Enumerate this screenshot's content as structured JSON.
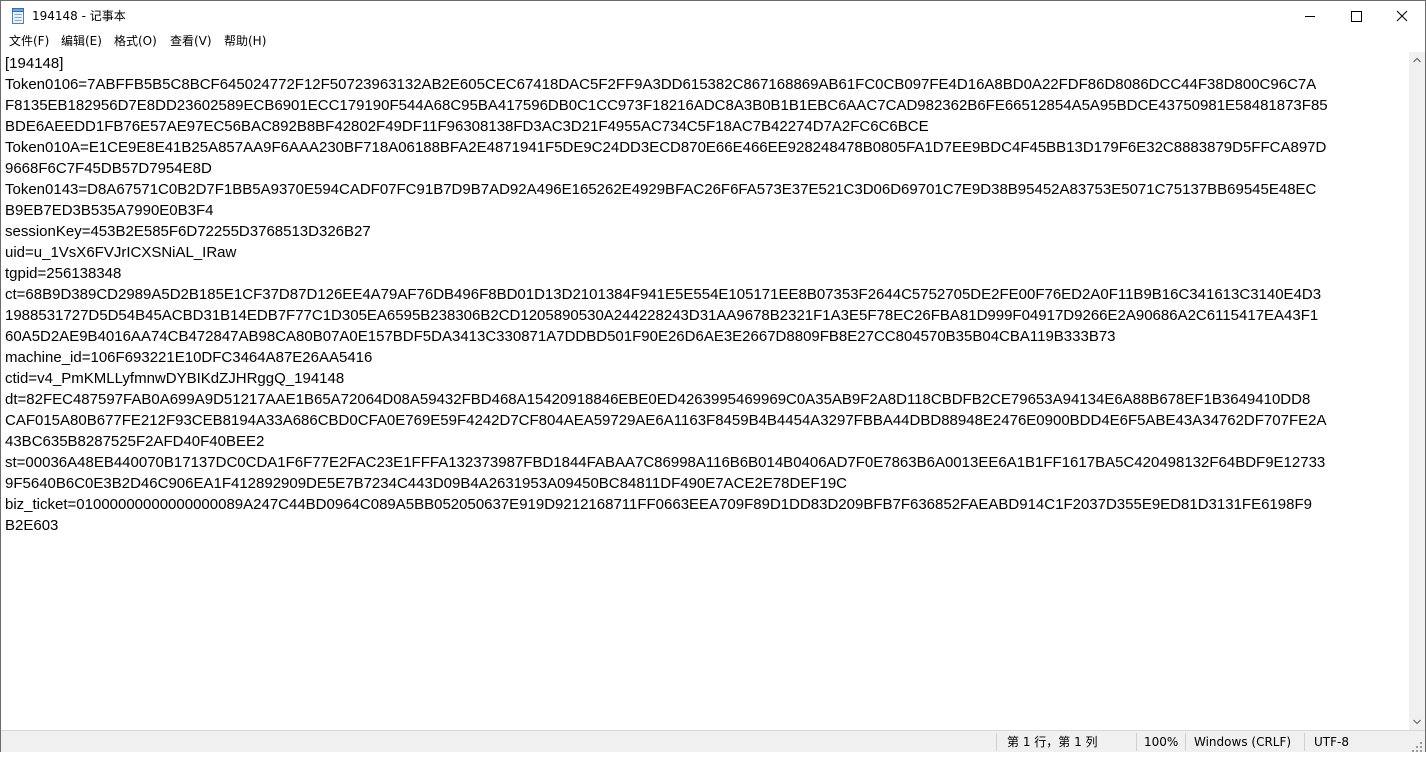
{
  "window": {
    "title": "194148 - 记事本",
    "app_icon": "notepad-icon",
    "controls": {
      "minimize": "minimize-icon",
      "maximize": "maximize-icon",
      "close": "close-icon"
    }
  },
  "menu": {
    "items": [
      {
        "label": "文件(F)"
      },
      {
        "label": "编辑(E)"
      },
      {
        "label": "格式(O)"
      },
      {
        "label": "查看(V)"
      },
      {
        "label": "帮助(H)"
      }
    ]
  },
  "editor": {
    "lines": [
      "[194148]",
      "Token0106=7ABFFB5B5C8BCF645024772F12F50723963132AB2E605CEC67418DAC5F2FF9A3DD615382C867168869AB61FC0CB097FE4D16A8BD0A22FDF86D8086DCC44F38D800C96C7A",
      "F8135EB182956D7E8DD23602589ECB6901ECC179190F544A68C95BA417596DB0C1CC973F18216ADC8A3B0B1B1EBC6AAC7CAD982362B6FE66512854A5A95BDCE43750981E58481873F85",
      "BDE6AEEDD1FB76E57AE97EC56BAC892B8BF42802F49DF11F96308138FD3AC3D21F4955AC734C5F18AC7B42274D7A2FC6C6BCE",
      "Token010A=E1CE9E8E41B25A857AA9F6AAA230BF718A06188BFA2E4871941F5DE9C24DD3ECD870E66E466EE928248478B0805FA1D7EE9BDC4F45BB13D179F6E32C8883879D5FFCA897D",
      "9668F6C7F45DB57D7954E8D",
      "Token0143=D8A67571C0B2D7F1BB5A9370E594CADF07FC91B7D9B7AD92A496E165262E4929BFAC26F6FA573E37E521C3D06D69701C7E9D38B95452A83753E5071C75137BB69545E48EC",
      "B9EB7ED3B535A7990E0B3F4",
      "sessionKey=453B2E585F6D72255D3768513D326B27",
      "uid=u_1VsX6FVJrICXSNiAL_IRaw",
      "tgpid=256138348",
      "ct=68B9D389CD2989A5D2B185E1CF37D87D126EE4A79AF76DB496F8BD01D13D2101384F941E5E554E105171EE8B07353F2644C5752705DE2FE00F76ED2A0F11B9B16C341613C3140E4D3",
      "1988531727D5D54B45ACBD31B14EDB7F77C1D305EA6595B238306B2CD1205890530A244228243D31AA9678B2321F1A3E5F78EC26FBA81D999F04917D9266E2A90686A2C6115417EA43F1",
      "60A5D2AE9B4016AA74CB472847AB98CA80B07A0E157BDF5DA3413C330871A7DDBD501F90E26D6AE3E2667D8809FB8E27CC804570B35B04CBA119B333B73",
      "machine_id=106F693221E10DFC3464A87E26AA5416",
      "ctid=v4_PmKMLLyfmnwDYBIKdZJHRggQ_194148",
      "dt=82FEC487597FAB0A699A9D51217AAE1B65A72064D08A59432FBD468A15420918846EBE0ED4263995469969C0A35AB9F2A8D118CBDFB2CE79653A94134E6A88B678EF1B3649410DD8",
      "CAF015A80B677FE212F93CEB8194A33A686CBD0CFA0E769E59F4242D7CF804AEA59729AE6A1163F8459B4B4454A3297FBBA44DBD88948E2476E0900BDD4E6F5ABE43A34762DF707FE2A",
      "43BC635B8287525F2AFD40F40BEE2",
      "st=00036A48EB440070B17137DC0CDA1F6F77E2FAC23E1FFFA132373987FBD1844FABAA7C86998A116B6B014B0406AD7F0E7863B6A0013EE6A1B1FF1617BA5C420498132F64BDF9E12733",
      "9F5640B6C0E3B2D46C906EA1F412892909DE5E7B7234C443D09B4A2631953A09450BC84811DF490E7ACE2E78DEF19C",
      "biz_ticket=01000000000000000089A247C44BD0964C089A5BB052050637E919D9212168711FF0663EEA709F89D1DD83D209BFB7F636852FAEABD914C1F2037D355E9ED81D3131FE6198F9",
      "B2E603"
    ]
  },
  "statusbar": {
    "position": "第 1 行，第 1 列",
    "zoom": "100%",
    "line_ending": "Windows (CRLF)",
    "encoding": "UTF-8"
  },
  "scrollbar": {
    "up": "scroll-up-arrow-icon",
    "down": "scroll-down-arrow-icon"
  },
  "colors": {
    "chrome": "#f0f0f0",
    "text": "#000000",
    "border": "#6b6b6b"
  }
}
